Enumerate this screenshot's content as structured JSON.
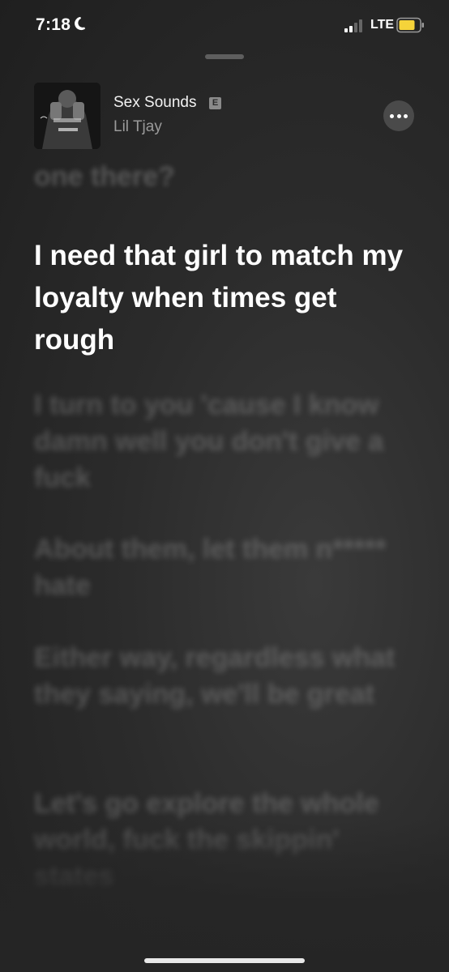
{
  "status_bar": {
    "time": "7:18",
    "network": "LTE",
    "battery_color": "#f5d33a",
    "icons": [
      "moon-icon",
      "signal-icon",
      "battery-icon"
    ]
  },
  "now_playing": {
    "title": "Sex Sounds",
    "explicit_badge": "E",
    "artist": "Lil Tjay",
    "more_icon": "ellipsis-icon"
  },
  "lyrics": {
    "previous": "one there?",
    "current": "I need that girl to match my loyalty when times get rough",
    "upcoming": [
      "I turn to you 'cause I know damn well you don't give a fuck",
      "About them, let them n***** hate",
      "Either way, regardless what they saying, we'll be great",
      "Let's go explore the whole world, fuck the skippin' states"
    ]
  }
}
